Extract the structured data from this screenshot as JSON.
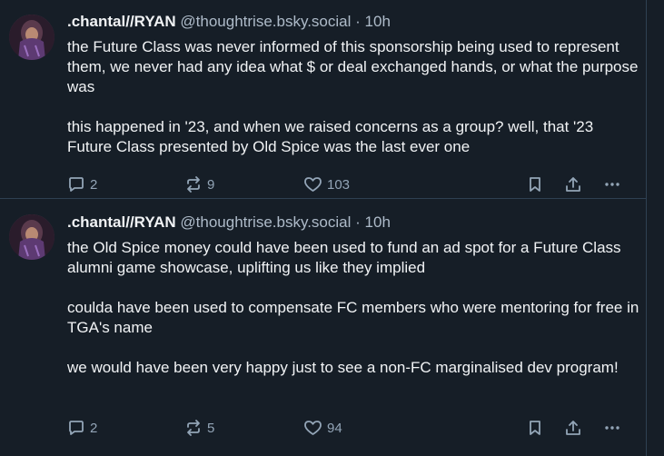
{
  "posts": [
    {
      "author": ".chantal//RYAN",
      "handle": "@thoughtrise.bsky.social",
      "separator": "·",
      "time": "10h",
      "paragraphs": [
        "the Future Class was never informed of this sponsorship being used to represent them, we never had any idea what $ or deal exchanged hands, or what the purpose was",
        "this happened in '23, and when we raised concerns as a group? well, that '23 Future Class presented by Old Spice was the last ever one"
      ],
      "replies": "2",
      "reposts": "9",
      "likes": "103"
    },
    {
      "author": ".chantal//RYAN",
      "handle": "@thoughtrise.bsky.social",
      "separator": "·",
      "time": "10h",
      "paragraphs": [
        "the Old Spice money could have been used to fund an ad spot for a Future Class alumni game showcase, uplifting us like they implied",
        "coulda have been used to compensate FC members who were mentoring for free in TGA's name",
        "we would have been very happy just to see a non-FC marginalised dev program!"
      ],
      "replies": "2",
      "reposts": "5",
      "likes": "94"
    }
  ],
  "icons": {
    "reply": "reply-icon",
    "repost": "repost-icon",
    "like": "heart-icon",
    "bookmark": "bookmark-icon",
    "share": "share-icon",
    "more": "more-icon"
  },
  "colors": {
    "background": "#161e27",
    "text": "#f1f3f5",
    "muted": "#aebbc9",
    "icon": "#93a5b7",
    "divider": "#2e4052"
  }
}
